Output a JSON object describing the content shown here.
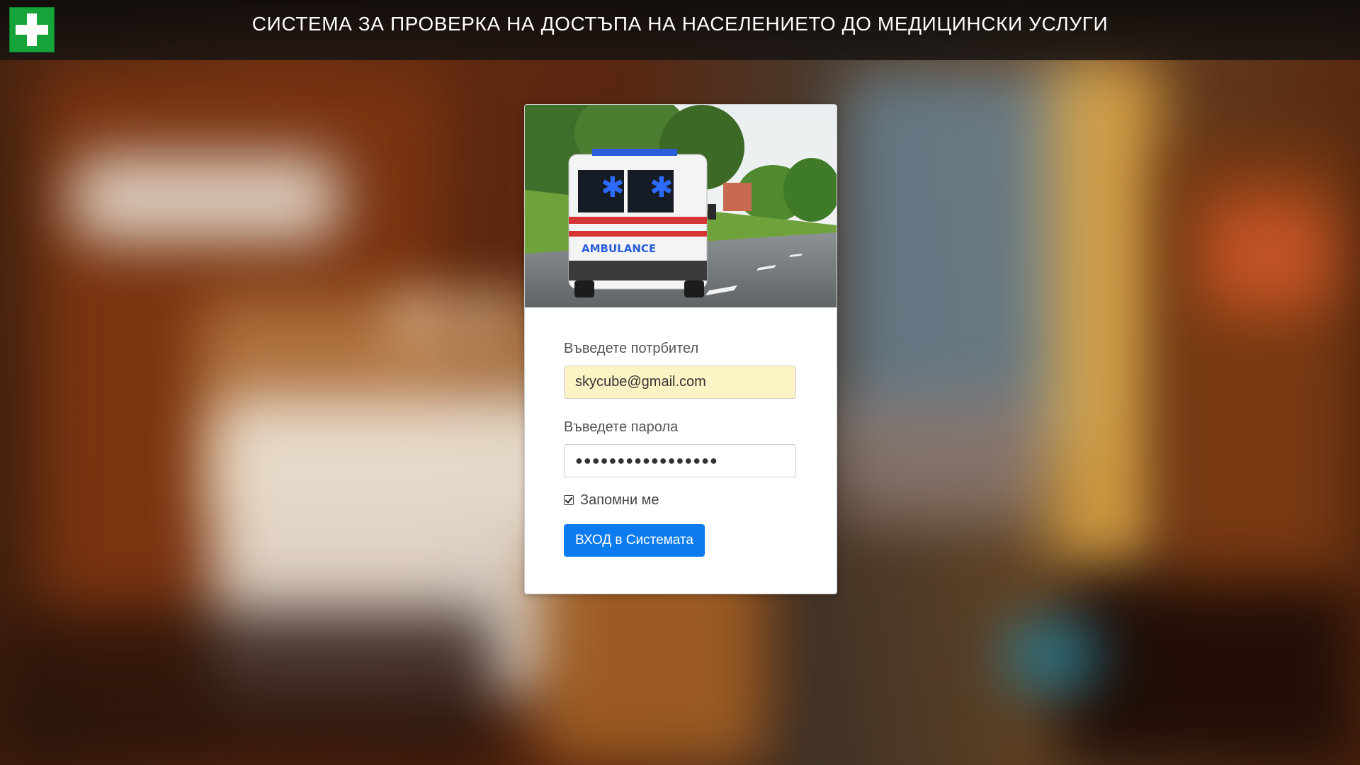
{
  "header": {
    "title": "СИСТЕМА ЗА ПРОВЕРКА НА ДОСТЪПА НА НАСЕЛЕНИЕТО ДО МЕДИЦИНСКИ УСЛУГИ",
    "logo_icon": "medical-cross-icon",
    "logo_color": "#15a33a"
  },
  "login": {
    "image_text": "AMBULANCE",
    "username_label": "Въведете потрбител",
    "username_value": "skycube@gmail.com",
    "password_label": "Въведете парола",
    "password_value": "●●●●●●●●●●●●●●●●●",
    "remember_label": "Запомни ме",
    "remember_checked": true,
    "submit_label": "ВХОД в Системата",
    "submit_color": "#0d7bf0"
  }
}
